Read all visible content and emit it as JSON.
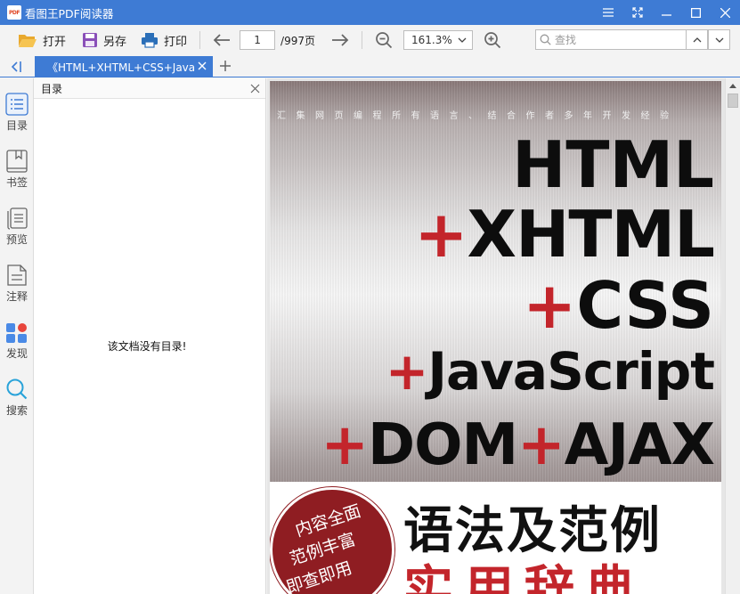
{
  "app": {
    "title": "看图王PDF阅读器",
    "logo_text": "PDF"
  },
  "window_controls": [
    "menu-icon",
    "fullscreen-icon",
    "minimize-icon",
    "maximize-icon",
    "close-icon"
  ],
  "toolbar": {
    "open_label": "打开",
    "saveas_label": "另存",
    "print_label": "打印",
    "page_current": "1",
    "page_total": "/997页",
    "zoom": "161.3%",
    "search_placeholder": "查找"
  },
  "tabs": [
    {
      "label": "《HTML+XHTML+CSS+JavaScript+DOM+AJAX语法及范例实用辞典》"
    }
  ],
  "sidebar": {
    "items": [
      {
        "label": "目录",
        "icon": "list-icon"
      },
      {
        "label": "书签",
        "icon": "bookmark-icon"
      },
      {
        "label": "预览",
        "icon": "pages-icon"
      },
      {
        "label": "注释",
        "icon": "note-icon"
      },
      {
        "label": "发现",
        "icon": "apps-icon"
      },
      {
        "label": "搜索",
        "icon": "search-icon"
      }
    ]
  },
  "toc": {
    "title": "目录",
    "empty_message": "该文档没有目录!"
  },
  "document": {
    "cover_tagline": "汇集网页编程所有语言、结合作者多年开发经验",
    "cover_lines": [
      "HTML",
      "+XHTML",
      "+CSS",
      "+JavaScript",
      "+DOM+AJAX"
    ],
    "cover_subtitle_1": "语法及范例",
    "cover_subtitle_2": "实用辞典",
    "circle_text": [
      "内容全面",
      "范例丰富",
      "即查即用"
    ]
  },
  "colors": {
    "accent": "#3e7bd4",
    "cover_red": "#c3252b",
    "circle_red": "#8f1d22"
  }
}
